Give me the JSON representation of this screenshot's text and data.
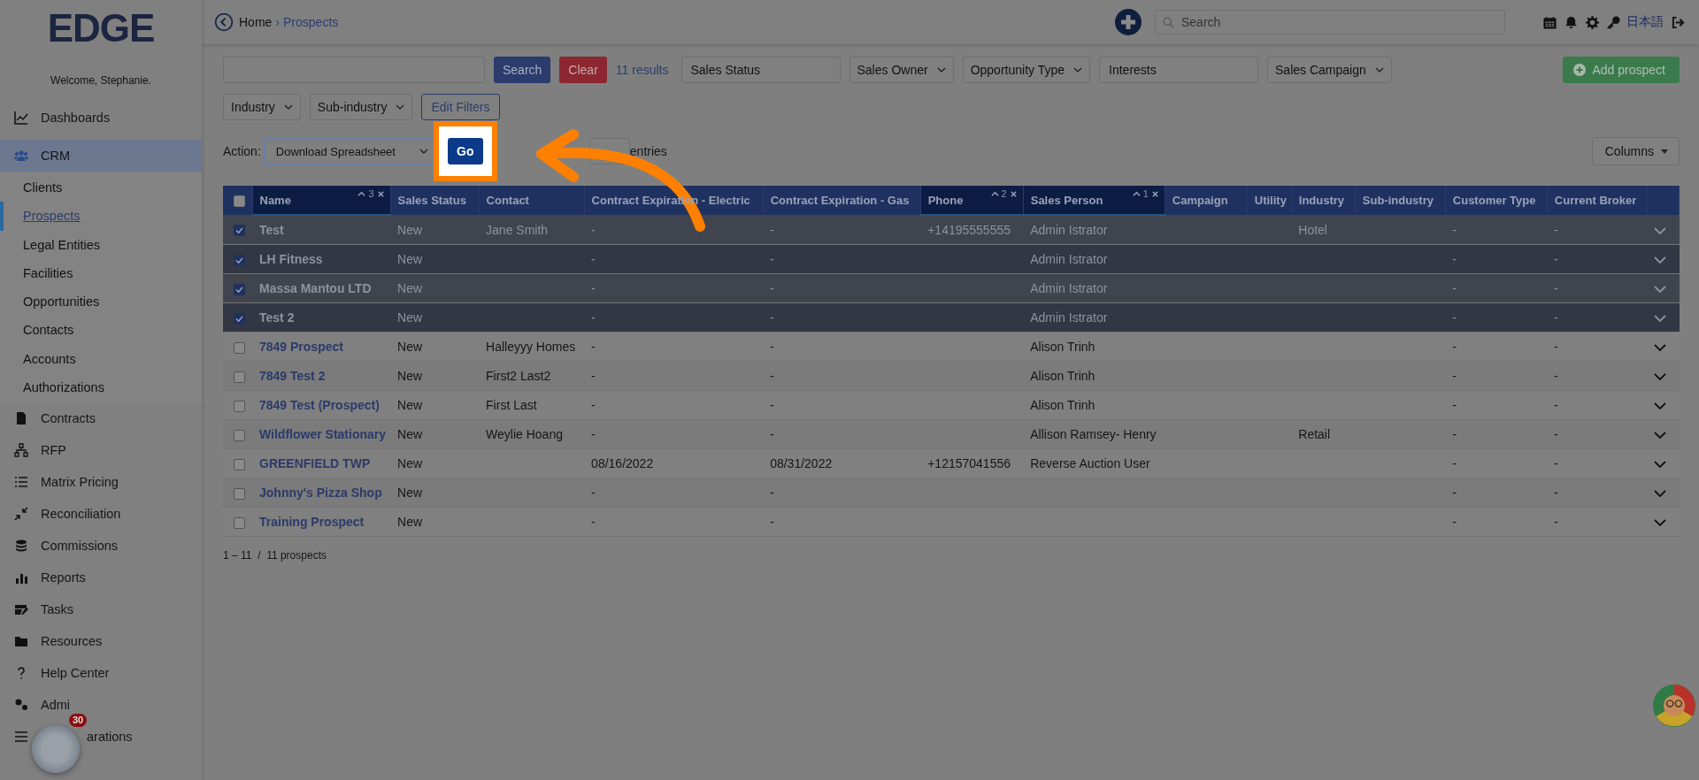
{
  "brand": {
    "logo": "EDGE",
    "welcome": "Welcome, Stephanie."
  },
  "sidebar": {
    "items": [
      {
        "label": "Dashboards",
        "selected": false
      },
      {
        "label": "CRM",
        "selected": true,
        "expanded": true,
        "children": [
          {
            "label": "Clients",
            "selected": false
          },
          {
            "label": "Prospects",
            "selected": true
          },
          {
            "label": "Legal Entities",
            "selected": false
          },
          {
            "label": "Facilities",
            "selected": false
          },
          {
            "label": "Opportunities",
            "selected": false
          },
          {
            "label": "Contacts",
            "selected": false
          },
          {
            "label": "Accounts",
            "selected": false
          },
          {
            "label": "Authorizations",
            "selected": false
          }
        ]
      },
      {
        "label": "Contracts",
        "selected": false
      },
      {
        "label": "RFP",
        "selected": false
      },
      {
        "label": "Matrix Pricing",
        "selected": false
      },
      {
        "label": "Reconciliation",
        "selected": false
      },
      {
        "label": "Commissions",
        "selected": false
      },
      {
        "label": "Reports",
        "selected": false
      },
      {
        "label": "Tasks",
        "selected": false
      },
      {
        "label": "Resources",
        "selected": false
      },
      {
        "label": "Help Center",
        "selected": false
      },
      {
        "label": "Admi",
        "selected": false
      },
      {
        "label": "arations",
        "selected": false
      }
    ]
  },
  "breadcrumb": {
    "items": [
      "Home",
      "Prospects"
    ],
    "separator": "›"
  },
  "topbar": {
    "search": {
      "placeholder": "Search"
    },
    "language": "日本語"
  },
  "filters": {
    "search_button": "Search",
    "clear_button": "Clear",
    "results": "11 results",
    "add_button": "Add prospect",
    "row_1": [
      {
        "kind": "input",
        "placeholder": "Sales Status"
      },
      {
        "kind": "select",
        "label": "Sales Owner"
      },
      {
        "kind": "select",
        "label": "Opportunity Type"
      },
      {
        "kind": "input",
        "placeholder": "Interests"
      },
      {
        "kind": "select",
        "label": "Sales Campaign"
      }
    ],
    "row_2": [
      {
        "kind": "select",
        "label": "Industry"
      },
      {
        "kind": "select",
        "label": "Sub-industry"
      },
      {
        "kind": "button",
        "label": "Edit Filters"
      }
    ]
  },
  "actions": {
    "label": "Action:",
    "selected_action": "Download Spreadsheet",
    "go_button": "Go",
    "entries": "entries",
    "columns_button": "Columns"
  },
  "table": {
    "all_selected": false,
    "columns": [
      {
        "label": "Name",
        "sorted": true,
        "sort_order": "3"
      },
      {
        "label": "Sales Status",
        "sorted": false
      },
      {
        "label": "Contact",
        "sorted": false
      },
      {
        "label": "Contract Expiration - Electric",
        "sorted": false
      },
      {
        "label": "Contract Expiration - Gas",
        "sorted": false
      },
      {
        "label": "Phone",
        "sorted": true,
        "sort_order": "2"
      },
      {
        "label": "Sales Person",
        "sorted": true,
        "sort_order": "1"
      },
      {
        "label": "Campaign",
        "sorted": false
      },
      {
        "label": "Utility",
        "sorted": false
      },
      {
        "label": "Industry",
        "sorted": false
      },
      {
        "label": "Sub-industry",
        "sorted": false
      },
      {
        "label": "Customer Type",
        "sorted": false
      },
      {
        "label": "Current Broker",
        "sorted": false
      }
    ],
    "rows": [
      {
        "selected": true,
        "name": "Test",
        "sales_status": "New",
        "contact": "Jane Smith",
        "electric": "-",
        "gas": "-",
        "phone": "+14195555555",
        "sales_person": "Admin Istrator",
        "industry": "Hotel",
        "customer_type": "-",
        "current_broker": "-"
      },
      {
        "selected": true,
        "name": "LH Fitness",
        "sales_status": "New",
        "electric": "-",
        "gas": "-",
        "sales_person": "Admin Istrator",
        "customer_type": "-",
        "current_broker": "-"
      },
      {
        "selected": true,
        "name": "Massa Mantou LTD",
        "sales_status": "New",
        "electric": "-",
        "gas": "-",
        "sales_person": "Admin Istrator",
        "customer_type": "-",
        "current_broker": "-"
      },
      {
        "selected": true,
        "name": "Test 2",
        "sales_status": "New",
        "electric": "-",
        "gas": "-",
        "sales_person": "Admin Istrator",
        "customer_type": "-",
        "current_broker": "-"
      },
      {
        "selected": false,
        "name": "7849 Prospect",
        "sales_status": "New",
        "contact": "Halleyyy Homes",
        "electric": "-",
        "gas": "-",
        "sales_person": "Alison Trinh",
        "customer_type": "-",
        "current_broker": "-"
      },
      {
        "selected": false,
        "name": "7849 Test 2",
        "sales_status": "New",
        "contact": "First2 Last2",
        "electric": "-",
        "gas": "-",
        "sales_person": "Alison Trinh",
        "customer_type": "-",
        "current_broker": "-"
      },
      {
        "selected": false,
        "name": "7849 Test (Prospect)",
        "sales_status": "New",
        "contact": "First Last",
        "electric": "-",
        "gas": "-",
        "sales_person": "Alison Trinh",
        "customer_type": "-",
        "current_broker": "-"
      },
      {
        "selected": false,
        "name": "Wildflower Stationary",
        "sales_status": "New",
        "contact": "Weylie Hoang",
        "electric": "-",
        "gas": "-",
        "sales_person": "Allison Ramsey- Henry",
        "industry": "Retail",
        "customer_type": "-",
        "current_broker": "-"
      },
      {
        "selected": false,
        "name": "GREENFIELD TWP",
        "sales_status": "New",
        "electric": "08/16/2022",
        "gas": "08/31/2022",
        "phone": "+12157041556",
        "sales_person": "Reverse Auction User",
        "customer_type": "-",
        "current_broker": "-"
      },
      {
        "selected": false,
        "name": "Johnny's Pizza Shop",
        "sales_status": "New",
        "electric": "-",
        "gas": "-",
        "customer_type": "-",
        "current_broker": "-"
      },
      {
        "selected": false,
        "name": "Training Prospect",
        "sales_status": "New",
        "electric": "-",
        "gas": "-",
        "customer_type": "-",
        "current_broker": "-"
      }
    ],
    "footer": "1 – 11  /  11 prospects"
  },
  "widget": {
    "badge": "30"
  }
}
